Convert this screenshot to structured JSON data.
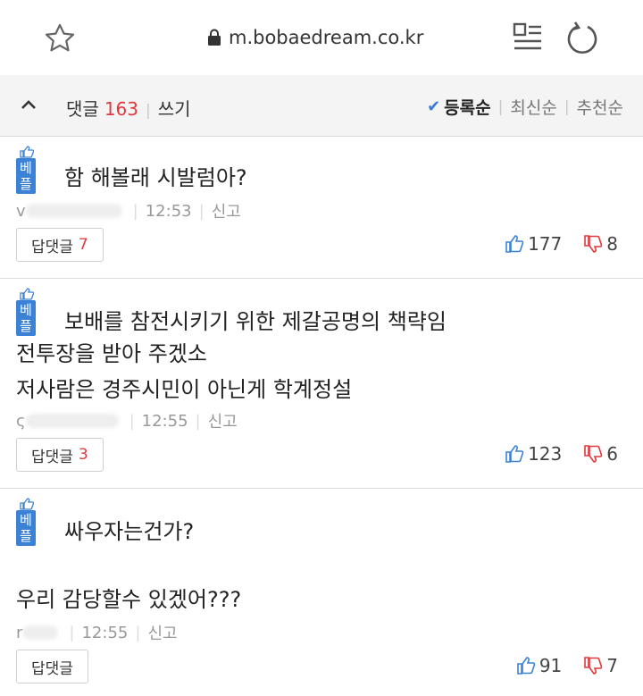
{
  "browser": {
    "url": "m.bobaedream.co.kr"
  },
  "comments_bar": {
    "label": "댓글",
    "count": "163",
    "write": "쓰기",
    "sort": {
      "active": "등록순",
      "recent": "최신순",
      "recommended": "추천순"
    }
  },
  "badge_label": "베플",
  "report_label": "신고",
  "reply_label": "답댓글",
  "comments": [
    {
      "lines": [
        "함 해볼래 시발럼아?"
      ],
      "author_visible": "v",
      "time": "12:53",
      "reply_count": "7",
      "likes": "177",
      "dislikes": "8"
    },
    {
      "lines": [
        "보배를 참전시키기 위한 제갈공명의 책략임",
        "전투장을 받아 주겠소",
        "저사람은 경주시민이 아닌게 학계정설"
      ],
      "author_visible": "ς",
      "time": "12:55",
      "reply_count": "3",
      "likes": "123",
      "dislikes": "6"
    },
    {
      "lines": [
        "싸우자는건가?",
        "우리 감당할수 있겠어???"
      ],
      "author_visible": "r",
      "time": "12:55",
      "reply_count": "",
      "likes": "91",
      "dislikes": "7"
    }
  ]
}
